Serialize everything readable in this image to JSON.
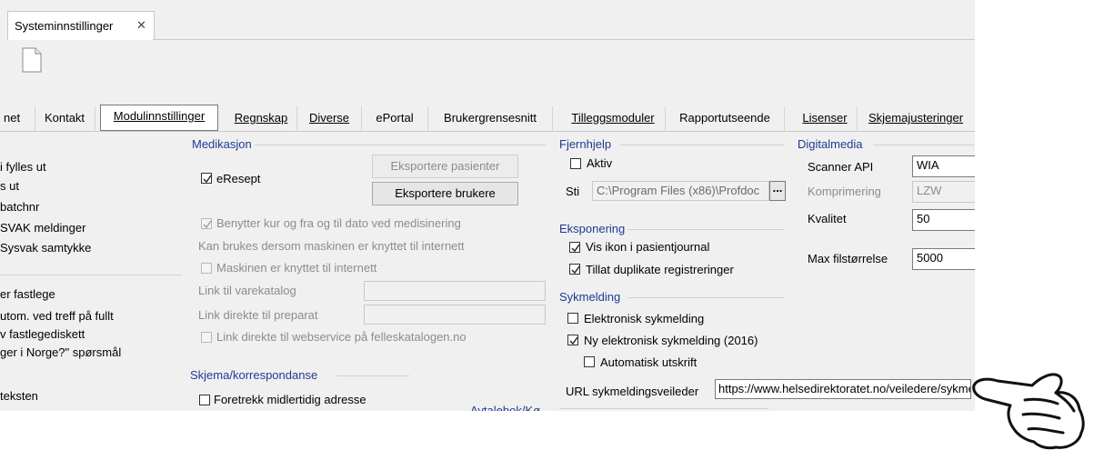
{
  "window": {
    "tab_title": "Systeminnstillinger",
    "close_glyph": "✕"
  },
  "tabs": [
    {
      "label": "net"
    },
    {
      "label": "Kontakt"
    },
    {
      "label": "Modulinnstillinger",
      "active": true
    },
    {
      "label": "Regnskap"
    },
    {
      "label": "Diverse"
    },
    {
      "label": "ePortal"
    },
    {
      "label": "Brukergrensesnitt"
    },
    {
      "label": "Tilleggsmoduler"
    },
    {
      "label": "Rapportutseende"
    },
    {
      "label": "Lisenser"
    },
    {
      "label": "Skjemajusteringer"
    }
  ],
  "left_column": [
    "i fylles ut",
    "s ut",
    " batchnr",
    "SVAK meldinger",
    "Sysvak samtykke",
    "er fastlege",
    "utom. ved treff på fullt",
    "v fastlegediskett",
    "ger i Norge?\" spørsmål",
    "teksten"
  ],
  "medikasjon": {
    "title": "Medikasjon",
    "eresept": {
      "label": "eResept",
      "checked": true
    },
    "export_patients": "Eksportere pasienter",
    "export_users": "Eksportere brukere",
    "kur": {
      "label": "Benytter kur og fra og til dato ved medisinering",
      "checked": true
    },
    "internet_note": "Kan brukes dersom maskinen er knyttet til internett",
    "machine_internet": {
      "label": "Maskinen er knyttet til internett",
      "checked": false
    },
    "varekatalog_label": "Link til varekatalog",
    "preparat_label": "Link direkte til preparat",
    "webservice": {
      "label": "Link direkte til webservice på felleskatalogen.no",
      "checked": false
    }
  },
  "skjema": {
    "title": "Skjema/korrespondanse",
    "foretrekk": {
      "label": "Foretrekk midlertidig adresse",
      "checked": false
    }
  },
  "avtalebok": {
    "title": "Avtalebok/Kø"
  },
  "fjernhjelp": {
    "title": "Fjernhjelp",
    "aktiv": {
      "label": "Aktiv",
      "checked": false
    },
    "sti_label": "Sti",
    "sti_value": "C:\\Program Files (x86)\\Profdoc",
    "browse": "..."
  },
  "eksponering": {
    "title": "Eksponering",
    "vis_ikon": {
      "label": "Vis ikon i pasientjournal",
      "checked": true
    },
    "duplikate": {
      "label": "Tillat duplikate registreringer",
      "checked": true
    }
  },
  "sykmelding": {
    "title": "Sykmelding",
    "elektronisk": {
      "label": "Elektronisk sykmelding",
      "checked": false
    },
    "ny": {
      "label": "Ny elektronisk sykmelding (2016)",
      "checked": true
    },
    "automatisk": {
      "label": "Automatisk utskrift",
      "checked": false
    },
    "url_label": "URL sykmeldingsveileder",
    "url_value": "https://www.helsedirektoratet.no/veiledere/sykmelding"
  },
  "digitalmedia": {
    "title": "Digitalmedia",
    "scanner_label": "Scanner API",
    "scanner_value": "WIA",
    "komprimering_label": "Komprimering",
    "komprimering_value": "LZW",
    "kvalitet_label": "Kvalitet",
    "kvalitet_value": "50",
    "max_label": "Max filstørrelse",
    "max_value": "5000"
  },
  "colors": {
    "group_title": "#1f3a93",
    "disabled_text": "#8c8c8c",
    "window_bg": "#f0f0f0"
  },
  "pointer_icon": "hand-pointer-icon"
}
